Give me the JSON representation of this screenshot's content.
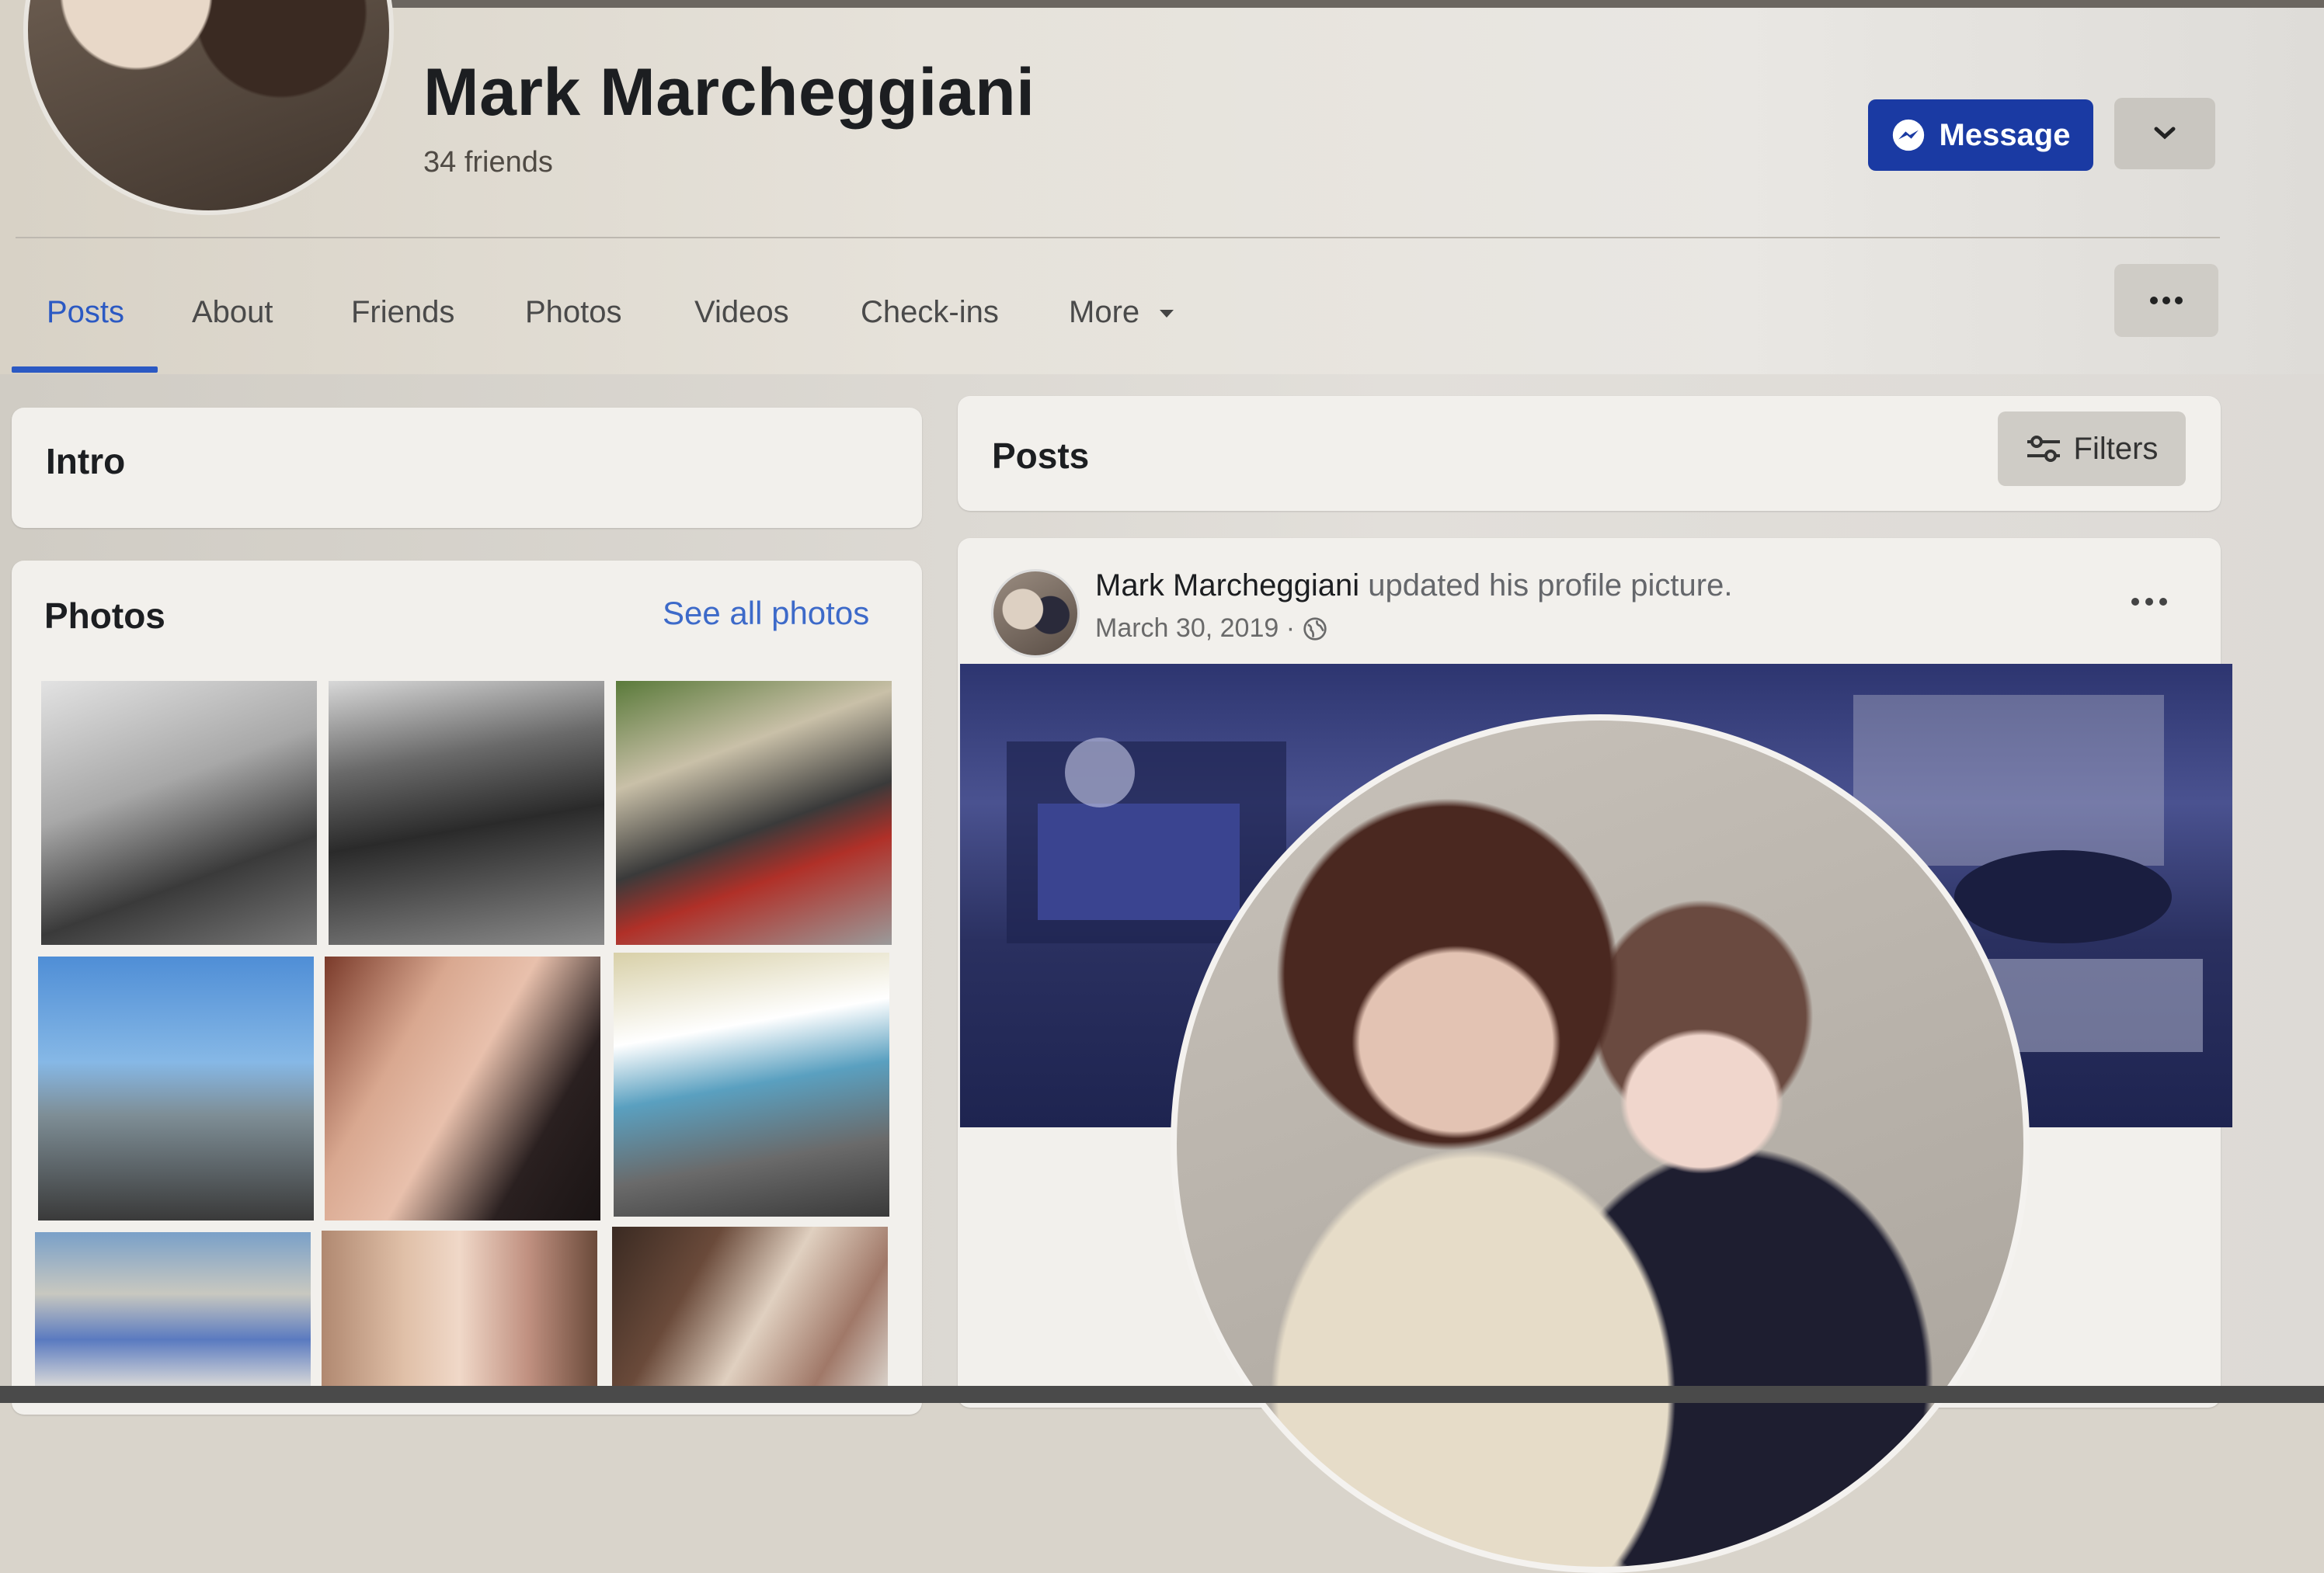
{
  "profile": {
    "name": "Mark Marcheggiani",
    "friends": "34 friends",
    "message_label": "Message"
  },
  "tabs": [
    "Posts",
    "About",
    "Friends",
    "Photos",
    "Videos",
    "Check-ins",
    "More"
  ],
  "active_tab": "Posts",
  "intro": {
    "title": "Intro"
  },
  "photos": {
    "title": "Photos",
    "see_all": "See all photos"
  },
  "posts": {
    "title": "Posts",
    "filters_label": "Filters",
    "items": [
      {
        "author": "Mark Marcheggiani",
        "action": "updated his profile picture.",
        "date": "March 30, 2019 · "
      }
    ]
  },
  "colors": {
    "accent": "#2b59c3",
    "message_button": "#1a3aa3"
  }
}
